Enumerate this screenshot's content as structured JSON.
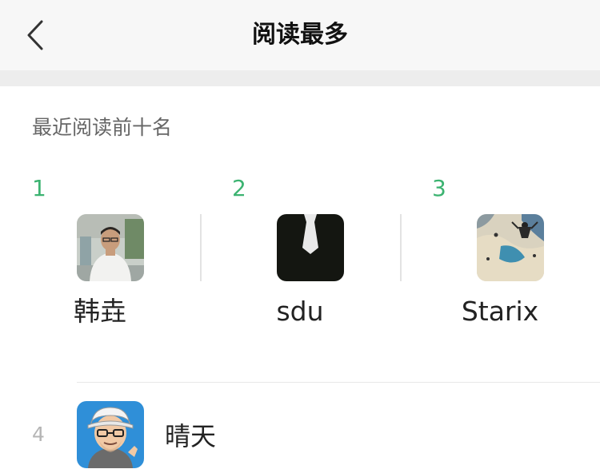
{
  "header": {
    "title": "阅读最多",
    "back_icon": "chevron-left-icon"
  },
  "section": {
    "title": "最近阅读前十名"
  },
  "podium": [
    {
      "rank": "1",
      "name": "韩垚",
      "avatar": "person-photo-avatar"
    },
    {
      "rank": "2",
      "name": "sdu",
      "avatar": "suit-tie-avatar"
    },
    {
      "rank": "3",
      "name": "Starix",
      "avatar": "skydiving-photo-avatar"
    }
  ],
  "list": [
    {
      "rank": "4",
      "name": "晴天",
      "avatar": "cartoon-man-avatar"
    }
  ],
  "colors": {
    "accent_green": "#3cb371",
    "nav_background": "#f7f7f7",
    "secondary_text": "#666666"
  }
}
